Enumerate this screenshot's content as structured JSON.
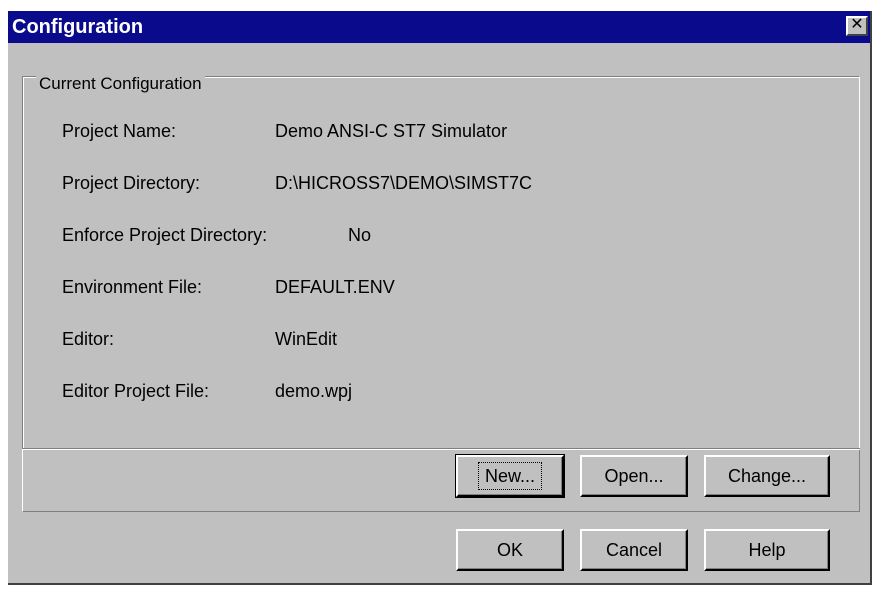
{
  "window": {
    "title": "Configuration",
    "close_glyph": "✕"
  },
  "group": {
    "legend": "Current Configuration"
  },
  "fields": [
    {
      "label": "Project Name:",
      "value": "Demo ANSI-C ST7 Simulator"
    },
    {
      "label": "Project Directory:",
      "value": "D:\\HICROSS7\\DEMO\\SIMST7C"
    },
    {
      "label": "Enforce Project Directory:",
      "value": "No"
    },
    {
      "label": "Environment File:",
      "value": "DEFAULT.ENV"
    },
    {
      "label": "Editor:",
      "value": "WinEdit"
    },
    {
      "label": "Editor Project File:",
      "value": "demo.wpj"
    }
  ],
  "config_buttons": {
    "new": "New...",
    "open": "Open...",
    "change": "Change..."
  },
  "dialog_buttons": {
    "ok": "OK",
    "cancel": "Cancel",
    "help": "Help"
  },
  "colors": {
    "titlebar": "#0a0a8c",
    "face": "#c0c0c0"
  }
}
